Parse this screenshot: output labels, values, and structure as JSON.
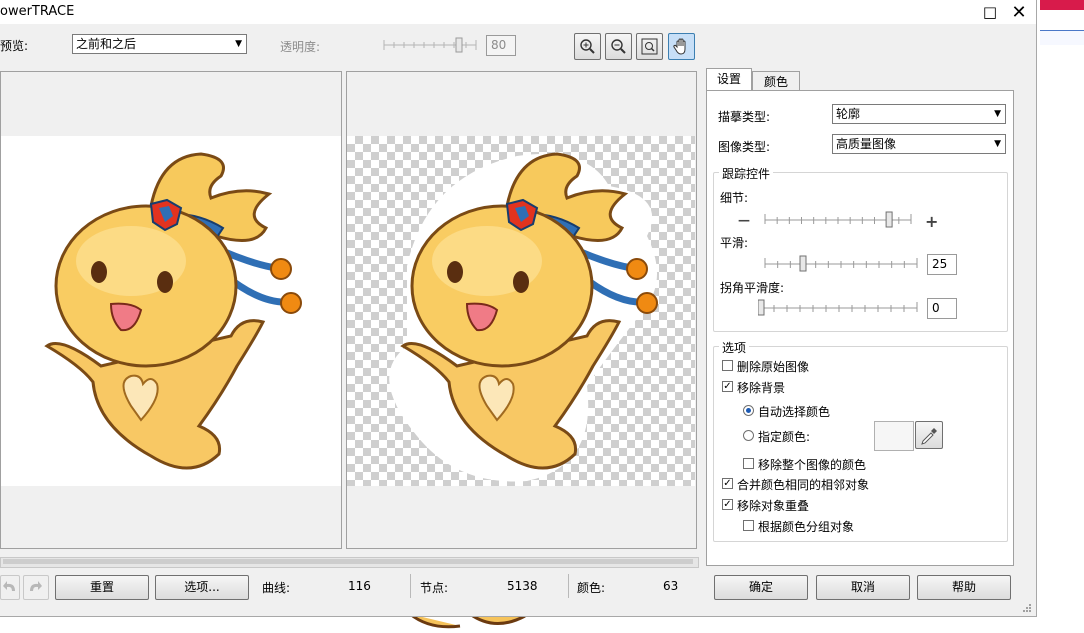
{
  "window": {
    "title": "owerTRACE"
  },
  "toolbar": {
    "preview_label": "预览:",
    "preview_value": "之前和之后",
    "transparency_label": "透明度:",
    "transparency_value": "80",
    "transparency_level_pct": 80
  },
  "tabs": [
    {
      "label": "设置"
    },
    {
      "label": "颜色"
    }
  ],
  "settings": {
    "trace_type_label": "描摹类型:",
    "trace_type_value": "轮廓",
    "image_type_label": "图像类型:",
    "image_type_value": "高质量图像",
    "trace_controls_title": "跟踪控件",
    "detail_label": "细节:",
    "detail_level": 0.85,
    "smoothing_label": "平滑:",
    "smoothing_value": "25",
    "corner_label": "拐角平滑度:",
    "corner_value": "0"
  },
  "options": {
    "title": "选项",
    "delete_original": "删除原始图像",
    "remove_bg": "移除背景",
    "auto_color": "自动选择颜色",
    "specify_color": "指定颜色:",
    "remove_whole_color": "移除整个图像的颜色",
    "merge_adjacent": "合并颜色相同的相邻对象",
    "remove_overlap": "移除对象重叠",
    "group_by_color": "根据颜色分组对象"
  },
  "bottom": {
    "reset": "重置",
    "options": "选项...",
    "curves_label": "曲线:",
    "curves_value": "116",
    "nodes_label": "节点:",
    "nodes_value": "5138",
    "colors_label": "颜色:",
    "colors_value": "63",
    "ok": "确定",
    "cancel": "取消",
    "help": "帮助"
  },
  "icons": [
    "zoom-in-icon",
    "zoom-out-icon",
    "fit-icon",
    "pan-hand-icon",
    "undo-icon",
    "redo-icon",
    "eyedropper-icon",
    "plus-icon",
    "minus-icon",
    "maximize-icon",
    "close-icon"
  ],
  "colors": {
    "accent": "#1c5ab4",
    "pan_active": "#c7dff7"
  }
}
